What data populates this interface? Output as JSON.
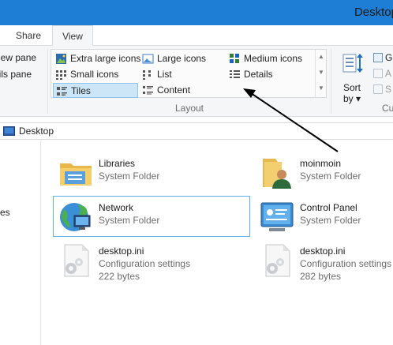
{
  "window": {
    "title": "Desktop"
  },
  "ribbon_tabs": {
    "share": "Share",
    "view": "View"
  },
  "panes_group": {
    "item1": "view pane",
    "item2": "ails pane"
  },
  "layout": {
    "group_label": "Layout",
    "options": [
      {
        "label": "Extra large icons",
        "icon": "extra-large-icons-icon"
      },
      {
        "label": "Large icons",
        "icon": "large-icons-icon"
      },
      {
        "label": "Medium icons",
        "icon": "medium-icons-icon"
      },
      {
        "label": "Small icons",
        "icon": "small-icons-icon"
      },
      {
        "label": "List",
        "icon": "list-icon"
      },
      {
        "label": "Details",
        "icon": "details-icon"
      },
      {
        "label": "Tiles",
        "icon": "tiles-icon",
        "selected": true
      },
      {
        "label": "Content",
        "icon": "content-icon"
      }
    ]
  },
  "current_view": {
    "sort_label": "Sort",
    "sort_sub": "by",
    "right_items": [
      "G",
      "A",
      "S"
    ],
    "group_label_partial": "Cu"
  },
  "address_bar": {
    "path": "Desktop"
  },
  "nav_pane": {
    "items": [
      "s",
      "ces",
      "s"
    ]
  },
  "files": [
    {
      "name": "Libraries",
      "type": "System Folder",
      "size": "",
      "icon": "libraries-icon"
    },
    {
      "name": "moinmoin",
      "type": "System Folder",
      "size": "",
      "icon": "user-folder-icon"
    },
    {
      "name": "Network",
      "type": "System Folder",
      "size": "",
      "icon": "network-icon",
      "selected": true
    },
    {
      "name": "Control Panel",
      "type": "System Folder",
      "size": "",
      "icon": "control-panel-icon"
    },
    {
      "name": "desktop.ini",
      "type": "Configuration settings",
      "size": "222 bytes",
      "icon": "config-file-icon"
    },
    {
      "name": "desktop.ini",
      "type": "Configuration settings",
      "size": "282 bytes",
      "icon": "config-file-icon"
    }
  ],
  "colors": {
    "titlebar": "#1e7ed6",
    "selection": "#cce6f7",
    "selection_border": "#8fc3ea",
    "tile_selection_border": "#5fb0e8"
  }
}
